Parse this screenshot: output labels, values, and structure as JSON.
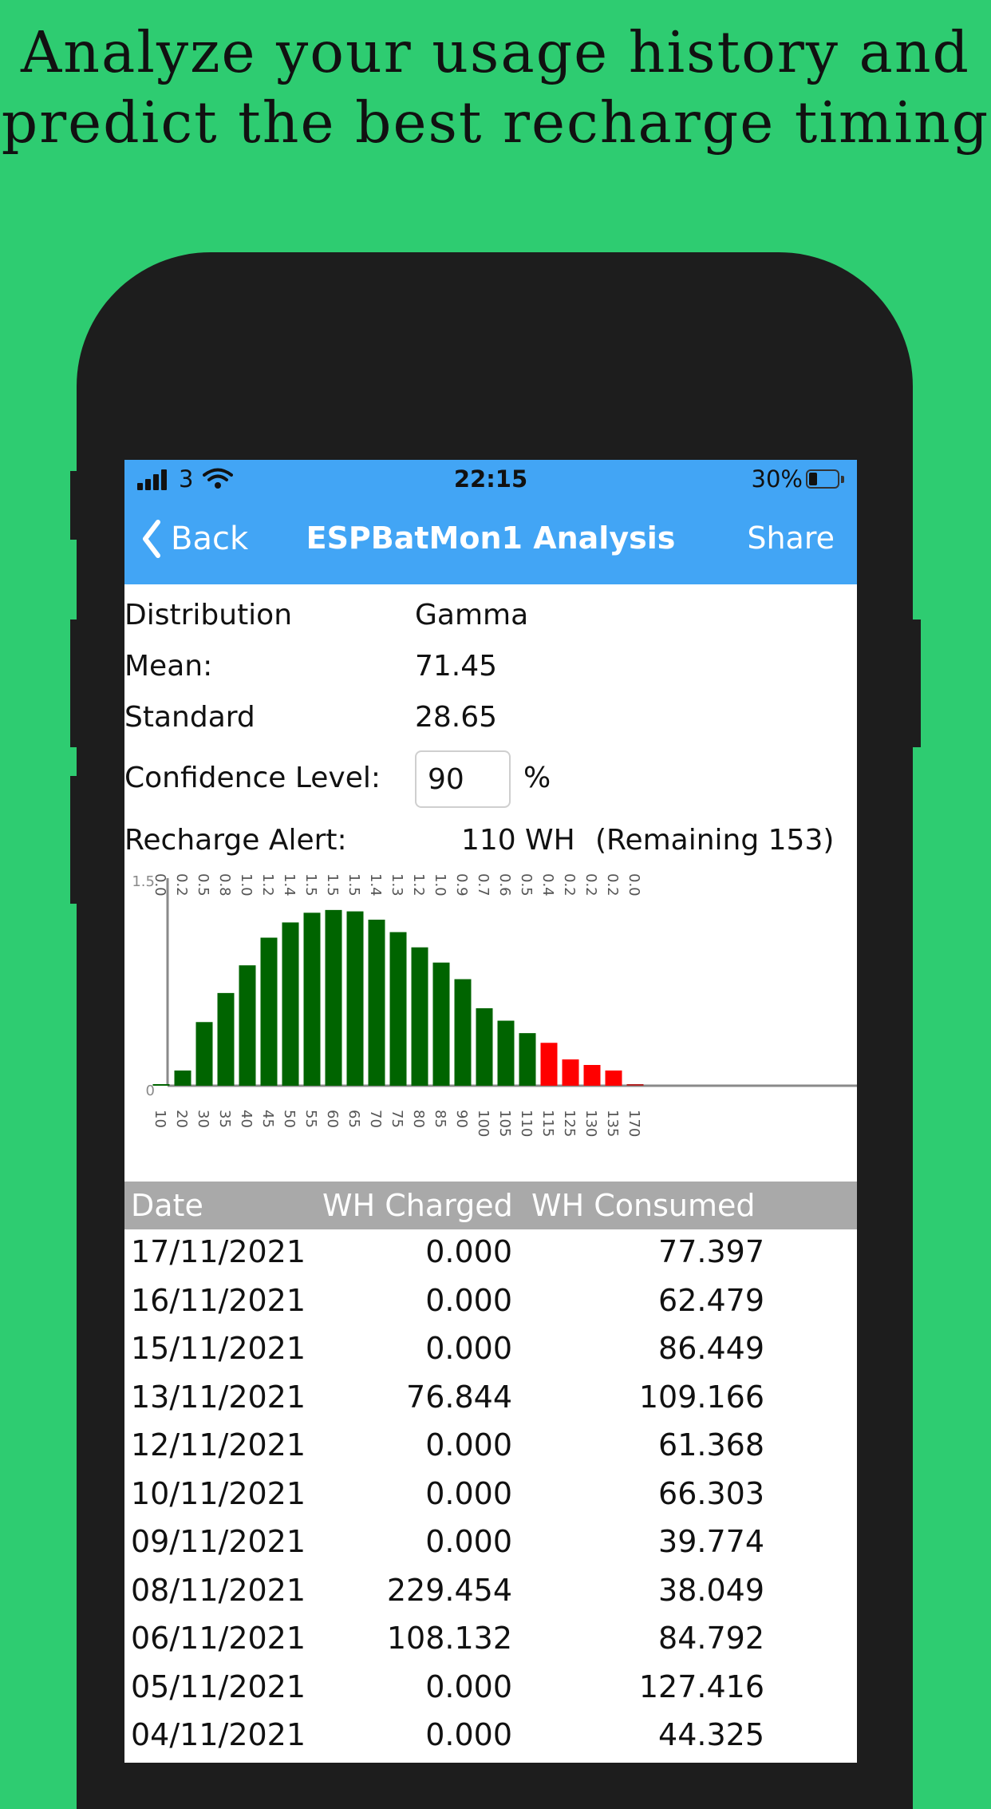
{
  "headline": {
    "line1": "Analyze your usage history and",
    "line2": "predict the best recharge timing"
  },
  "status_bar": {
    "carrier": "3",
    "time": "22:15",
    "battery": "30%",
    "battery_level": 0.3
  },
  "nav": {
    "back_label": "Back",
    "title": "ESPBatMon1 Analysis",
    "share_label": "Share"
  },
  "info": {
    "distribution_label": "Distribution",
    "distribution_value": "Gamma",
    "mean_label": "Mean:",
    "mean_value": "71.45",
    "std_label": "Standard",
    "std_value": "28.65",
    "confidence_label": "Confidence Level:",
    "confidence_value": "90",
    "confidence_unit": "%",
    "alert_label": "Recharge Alert:",
    "alert_value": "110",
    "alert_unit": "WH",
    "remaining_text": "(Remaining 153)"
  },
  "chart_data": {
    "type": "bar",
    "ylim": [
      0,
      1.5
    ],
    "y_ticks": [
      "1.5",
      "0"
    ],
    "categories": [
      "10",
      "20",
      "30",
      "35",
      "40",
      "45",
      "50",
      "55",
      "60",
      "65",
      "70",
      "75",
      "80",
      "85",
      "90",
      "100",
      "105",
      "110",
      "115",
      "125",
      "130",
      "135",
      "170"
    ],
    "values": [
      0.0,
      0.11,
      0.46,
      0.67,
      0.87,
      1.07,
      1.18,
      1.25,
      1.27,
      1.26,
      1.2,
      1.11,
      1.0,
      0.89,
      0.77,
      0.56,
      0.47,
      0.38,
      0.31,
      0.19,
      0.15,
      0.11,
      0.01
    ],
    "value_labels": [
      "0.0",
      "0.2",
      "0.5",
      "0.8",
      "1.0",
      "1.2",
      "1.4",
      "1.5",
      "1.5",
      "1.5",
      "1.4",
      "1.3",
      "1.2",
      "1.0",
      "0.9",
      "0.7",
      "0.6",
      "0.5",
      "0.4",
      "0.2",
      "0.2",
      "0.2",
      "0.0"
    ],
    "colors": {
      "normal": "#006400",
      "alert": "#ff0000",
      "alert_last": "#b22222"
    },
    "alert_from_category": "115",
    "grid": false
  },
  "table": {
    "headers": [
      "Date",
      "WH Charged",
      "WH Consumed"
    ],
    "rows": [
      {
        "date": "17/11/2021",
        "charged": "0.000",
        "consumed": "77.397"
      },
      {
        "date": "16/11/2021",
        "charged": "0.000",
        "consumed": "62.479"
      },
      {
        "date": "15/11/2021",
        "charged": "0.000",
        "consumed": "86.449"
      },
      {
        "date": "13/11/2021",
        "charged": "76.844",
        "consumed": "109.166"
      },
      {
        "date": "12/11/2021",
        "charged": "0.000",
        "consumed": "61.368"
      },
      {
        "date": "10/11/2021",
        "charged": "0.000",
        "consumed": "66.303"
      },
      {
        "date": "09/11/2021",
        "charged": "0.000",
        "consumed": "39.774"
      },
      {
        "date": "08/11/2021",
        "charged": "229.454",
        "consumed": "38.049"
      },
      {
        "date": "06/11/2021",
        "charged": "108.132",
        "consumed": "84.792"
      },
      {
        "date": "05/11/2021",
        "charged": "0.000",
        "consumed": "127.416"
      },
      {
        "date": "04/11/2021",
        "charged": "0.000",
        "consumed": "44.325"
      }
    ]
  },
  "colors": {
    "background": "#2ecc71",
    "navbar": "#42a5f5",
    "table_header": "#a9a9a9"
  }
}
